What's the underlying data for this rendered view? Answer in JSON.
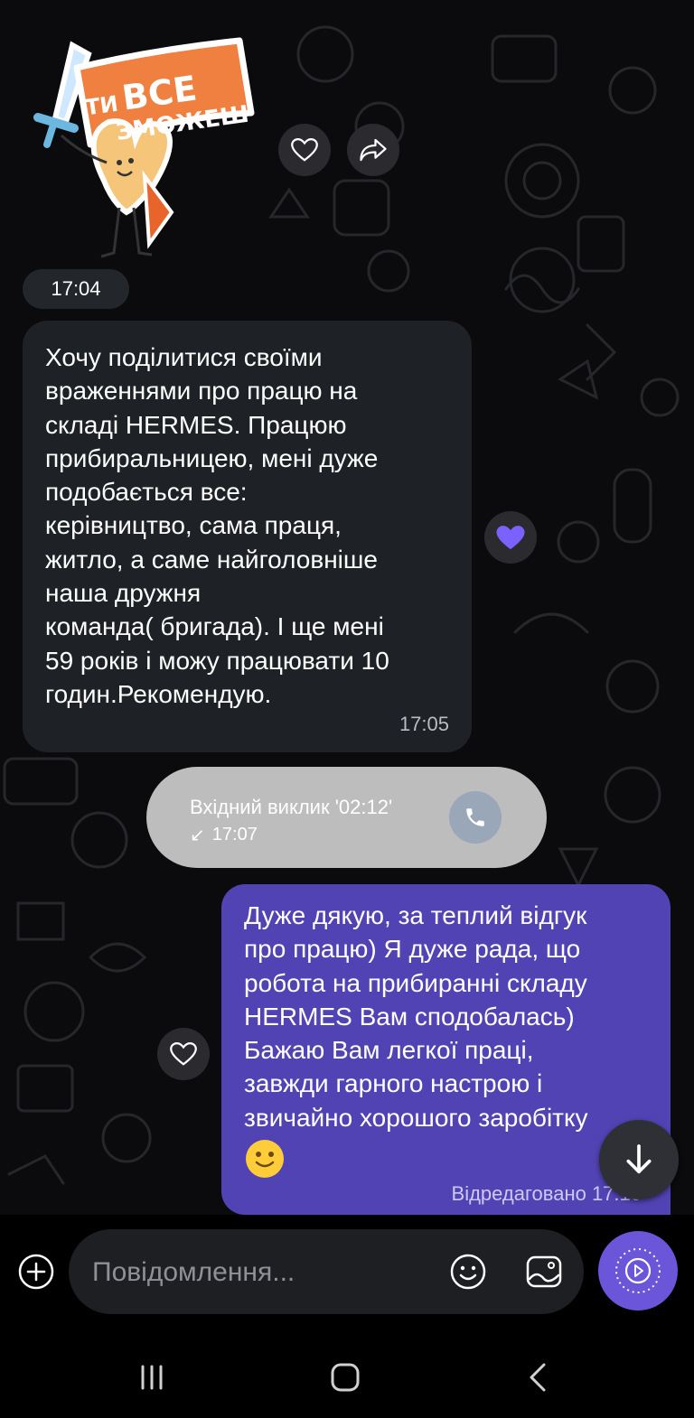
{
  "sticker": {
    "line1": "ТИ",
    "line2": "ВСЕ",
    "line3": "ЗМОЖЕШ"
  },
  "messages": {
    "first_time": "17:04",
    "incoming": {
      "text": "Хочу поділитися своїми\nвраженнями   про працю на\nскладі HERMES. Працюю\nприбиральницею, мені дуже\nподобається все:\nкерівництво, сама праця,\nжитло, а саме найголовніше\nнаша дружня\nкоманда( бригада). І ще мені\n59 років і можу працювати 10\nгодин.Рекомендую.",
      "time": "17:05"
    },
    "call": {
      "title": "Вхідний виклик '02:12'",
      "time": "17:07",
      "arrow": "↙"
    },
    "outgoing": {
      "text": "Дуже дякую, за теплий відгук\nпро працю)  Я дуже рада, що\nробота на прибиранні складу\nHERMES  Вам сподобалась)\nБажаю Вам легкої праці,\nзавжди гарного настрою і\nзвичайно хорошого заробітку",
      "status": "Відредаговано 17:10"
    }
  },
  "composer": {
    "placeholder": "Повідомлення..."
  },
  "icons": {
    "heart": "heart-icon",
    "forward": "forward-icon",
    "phone": "phone-icon",
    "scroll": "arrow-down-icon",
    "plus": "plus-icon",
    "emoji": "smiley-icon",
    "gallery": "gallery-icon",
    "send": "voice-record-icon"
  },
  "colors": {
    "incoming_bubble": "#1e2126",
    "outgoing_bubble": "#5243b4",
    "accent": "#6b55d8",
    "reaction_heart": "#7b61ff",
    "call_bubble": "#bdbdbd"
  }
}
